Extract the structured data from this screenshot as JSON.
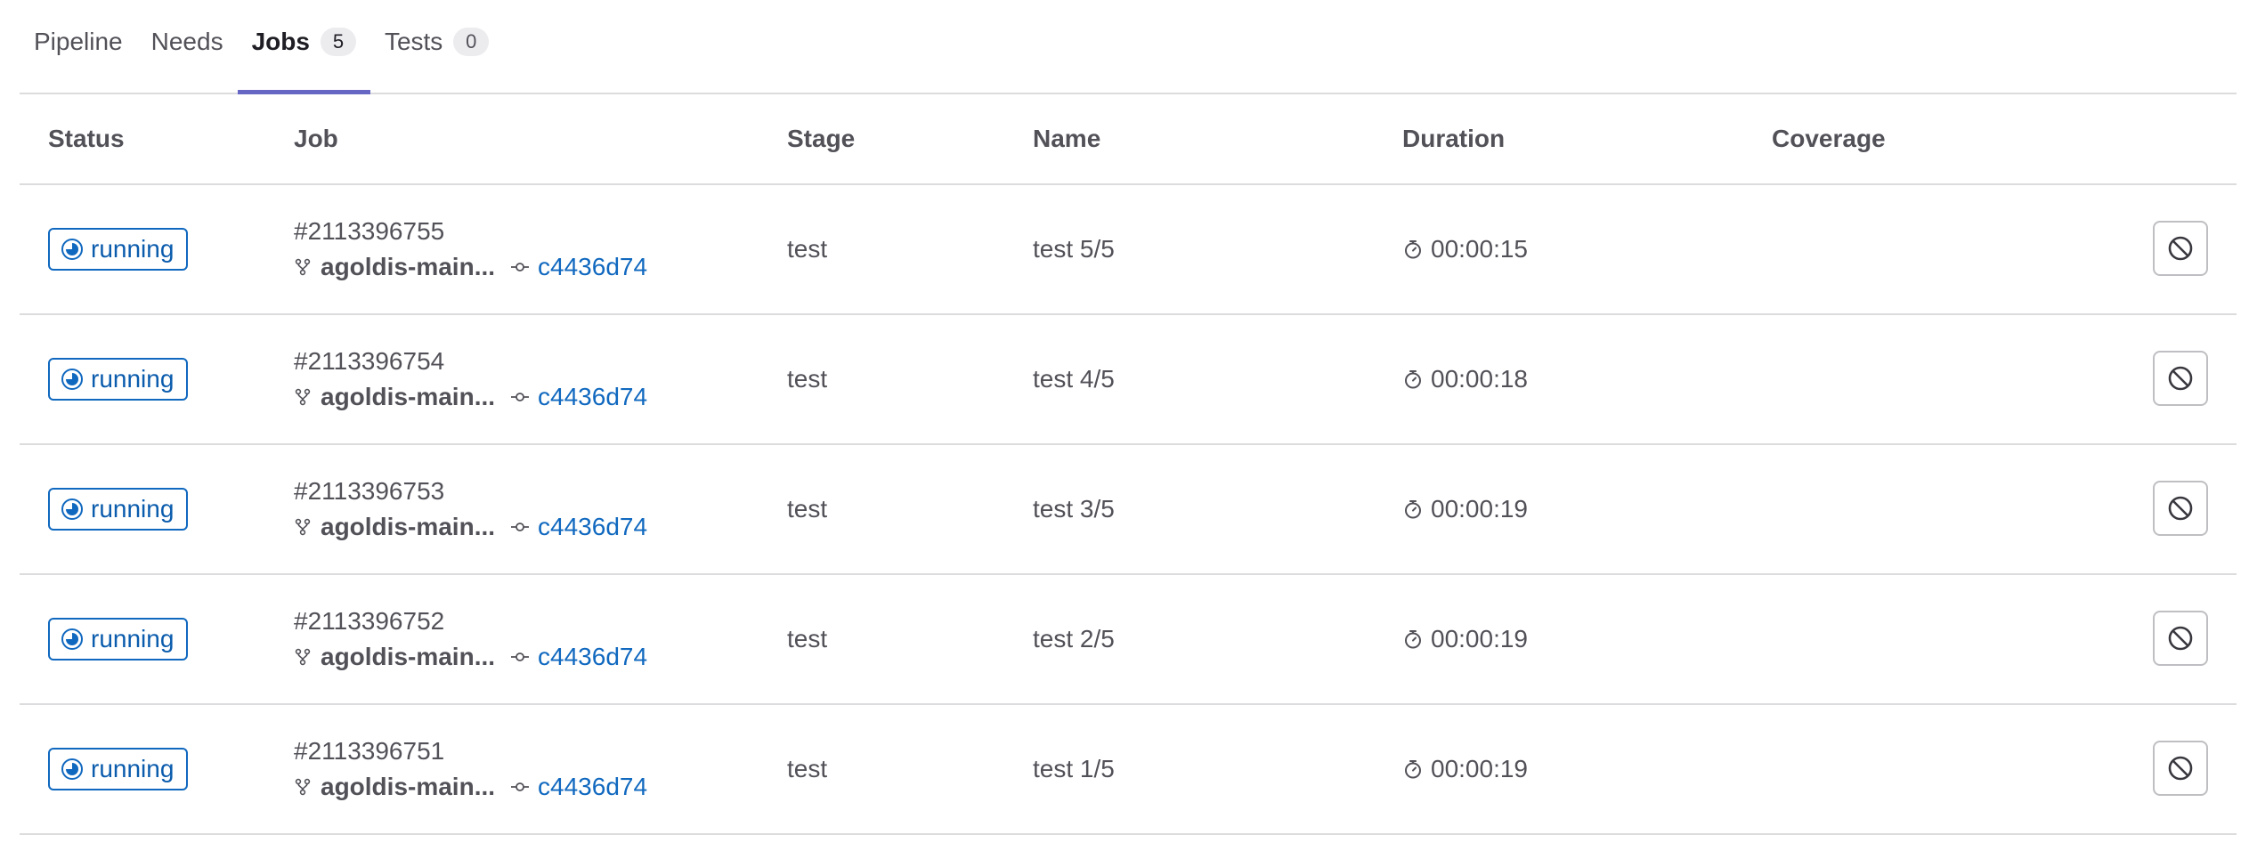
{
  "tabs": [
    {
      "label": "Pipeline",
      "count": null
    },
    {
      "label": "Needs",
      "count": null
    },
    {
      "label": "Jobs",
      "count": "5"
    },
    {
      "label": "Tests",
      "count": "0"
    }
  ],
  "active_tab": "Jobs",
  "table": {
    "headers": {
      "status": "Status",
      "job": "Job",
      "stage": "Stage",
      "name": "Name",
      "duration": "Duration",
      "coverage": "Coverage"
    },
    "rows": [
      {
        "status": "running",
        "job_id": "#2113396755",
        "branch": "agoldis-main...",
        "commit": "c4436d74",
        "stage": "test",
        "name": "test 5/5",
        "duration": "00:00:15",
        "coverage": ""
      },
      {
        "status": "running",
        "job_id": "#2113396754",
        "branch": "agoldis-main...",
        "commit": "c4436d74",
        "stage": "test",
        "name": "test 4/5",
        "duration": "00:00:18",
        "coverage": ""
      },
      {
        "status": "running",
        "job_id": "#2113396753",
        "branch": "agoldis-main...",
        "commit": "c4436d74",
        "stage": "test",
        "name": "test 3/5",
        "duration": "00:00:19",
        "coverage": ""
      },
      {
        "status": "running",
        "job_id": "#2113396752",
        "branch": "agoldis-main...",
        "commit": "c4436d74",
        "stage": "test",
        "name": "test 2/5",
        "duration": "00:00:19",
        "coverage": ""
      },
      {
        "status": "running",
        "job_id": "#2113396751",
        "branch": "agoldis-main...",
        "commit": "c4436d74",
        "stage": "test",
        "name": "test 1/5",
        "duration": "00:00:19",
        "coverage": ""
      }
    ]
  },
  "icons": {
    "status": "status-running-icon",
    "branch": "branch-icon",
    "commit": "commit-icon",
    "duration": "timer-icon",
    "action": "cancel-icon"
  },
  "colors": {
    "accent": "#6666c4",
    "running": "#1068bf",
    "link": "#1068bf",
    "border": "#dcdcde"
  }
}
